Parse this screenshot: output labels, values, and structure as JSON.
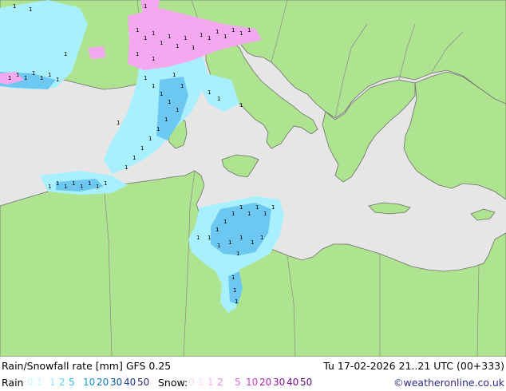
{
  "map": {
    "colors": {
      "sea": "#e6e6e6",
      "land": "#aee48f",
      "border": "#8a8a8a",
      "coast": "#6e6e6e",
      "rain_light": "#a8f0ff",
      "rain_mid": "#6cc8f0",
      "snow": "#f4a8f0",
      "marker": "#000000"
    }
  },
  "footer": {
    "title": "Rain/Snowfall rate [mm] GFS 0.25",
    "valid_time": "Tu 17-02-2026 21..21 UTC (00+333)",
    "rain_label": "Rain",
    "snow_label": "Snow:",
    "credit": "©weatheronline.co.uk",
    "rain_legend": [
      {
        "label": "0.1",
        "color": "#c8f4ff"
      },
      {
        "label": "1",
        "color": "#96e6ff"
      },
      {
        "label": "2",
        "color": "#64d2ff"
      },
      {
        "label": "5",
        "color": "#32b4f0"
      },
      {
        "label": "10",
        "color": "#1496dc"
      },
      {
        "label": "20",
        "color": "#0a78c8"
      },
      {
        "label": "30",
        "color": "#0a50a0"
      },
      {
        "label": "40",
        "color": "#1e3c8c"
      },
      {
        "label": "50",
        "color": "#28287a"
      }
    ],
    "snow_legend": [
      {
        "label": "0.1",
        "color": "#fadcfa"
      },
      {
        "label": "1",
        "color": "#f5b4f5"
      },
      {
        "label": "2",
        "color": "#f08cf0"
      },
      {
        "label": "5",
        "color": "#e664e6"
      },
      {
        "label": "10",
        "color": "#d23cd2"
      },
      {
        "label": "20",
        "color": "#b41eb4"
      },
      {
        "label": "30",
        "color": "#9614a0"
      },
      {
        "label": "40",
        "color": "#780a8c"
      },
      {
        "label": "50",
        "color": "#5a0578"
      }
    ]
  }
}
